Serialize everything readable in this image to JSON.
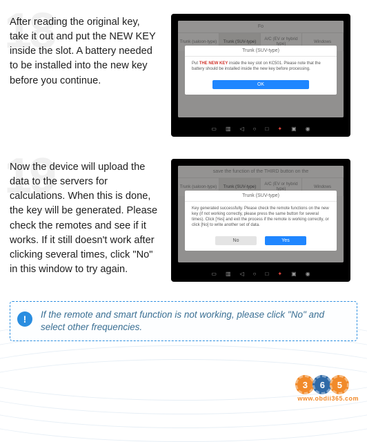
{
  "step1": {
    "number": "18",
    "text": "After reading the original key, take it out and put the NEW KEY inside the slot. A battery needed to be installed into the new key before you continue.",
    "app_header": "Fo",
    "tabs": [
      "Trunk (saloon-type)",
      "Trunk (SUV-type)",
      "A/C (EV or hybrid type)",
      "Windows"
    ],
    "modal_title": "Trunk (SUV-type)",
    "modal_body_pre": "Put ",
    "modal_body_red": "THE NEW KEY",
    "modal_body_post": " inside the key slot on KC501. Please note that the battery should be installed inside the new key before processing.",
    "ok": "OK"
  },
  "step2": {
    "number": "19",
    "text": "Now the device will upload the data to the servers for calculations. When this is done, the key will be generated. Please check the remotes and see if it works. If it still doesn't work after clicking several times, click \"No\" in this window to try again.",
    "app_header": "save the function of the THIRD button on the",
    "tabs": [
      "Trunk (saloon-type)",
      "Trunk (SUV-type)",
      "A/C (EV or hybrid type)",
      "Windows"
    ],
    "modal_title": "Trunk (SUV-type)",
    "modal_body": "Key generated successfully. Please check the remote functions on the new key (if not working correctly, please press the same button for several times). Click [Yes] and exit the process if the remote is working correctly, or click [No] to write another set of data.",
    "no": "No",
    "yes": "Yes"
  },
  "note": {
    "icon": "!",
    "text": "If the remote and smart function is not working, please click \"No\" and select other frequencies."
  },
  "logo": {
    "g1": "3",
    "g2": "6",
    "g3": "5",
    "url": "www.obdii365.com"
  }
}
